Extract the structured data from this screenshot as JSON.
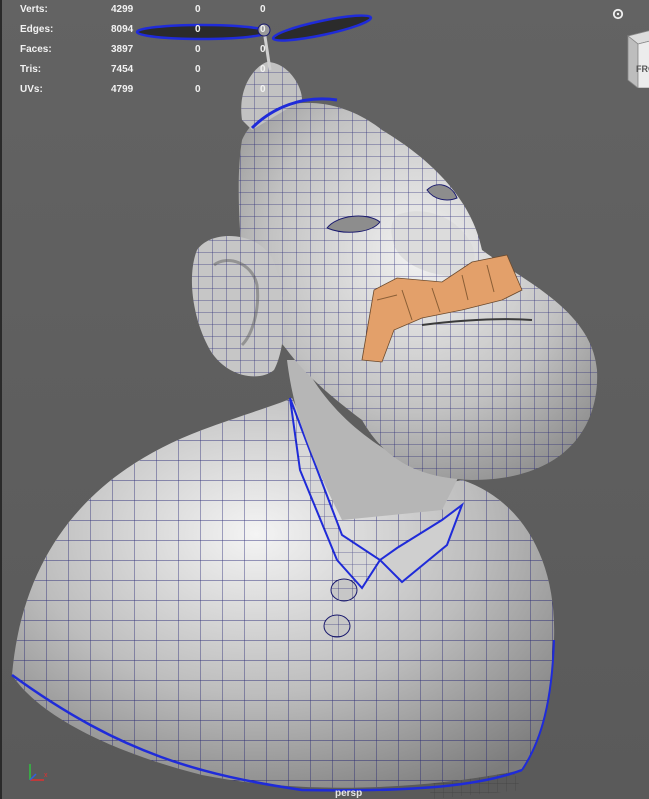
{
  "hud": {
    "rows": [
      {
        "label": "Verts:",
        "a": "4299",
        "b": "0",
        "c": "0"
      },
      {
        "label": "Edges:",
        "a": "8094",
        "b": "0",
        "c": "0"
      },
      {
        "label": "Faces:",
        "a": "3897",
        "b": "0",
        "c": "0"
      },
      {
        "label": "Tris:",
        "a": "7454",
        "b": "0",
        "c": "0"
      },
      {
        "label": "UVs:",
        "a": "4799",
        "b": "0",
        "c": "0"
      }
    ]
  },
  "view_cube": {
    "face_label": "FRO"
  },
  "camera": {
    "name": "persp"
  },
  "axis": {
    "x": "x",
    "y": "y",
    "z": "z"
  },
  "colors": {
    "viewport_bg": "#5f5f5f",
    "mesh_fill": "#c9c9c9",
    "wire": "#1a1a6e",
    "selection": "#1f2bd9",
    "mustache": "#e3a06a",
    "hud_text": "#f2f2f2"
  }
}
